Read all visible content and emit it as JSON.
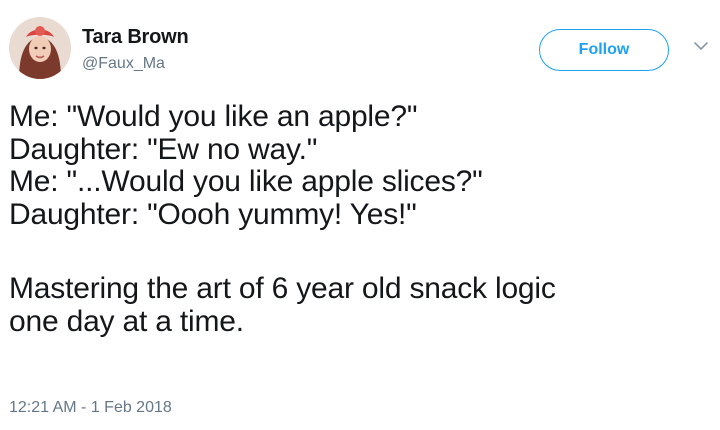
{
  "author": {
    "name": "Tara Brown",
    "handle": "@Faux_Ma"
  },
  "actions": {
    "follow_label": "Follow",
    "menu_icon": "chevron-down-icon"
  },
  "tweet": {
    "lines": [
      "Me: \"Would you like an apple?\"",
      "Daughter: \"Ew no way.\"",
      "Me: \"...Would you like apple slices?\"",
      "Daughter: \"Oooh yummy! Yes!\""
    ],
    "closing_lines": [
      "Mastering the art of 6 year old snack logic",
      "one day at a time."
    ],
    "timestamp": "12:21 AM - 1 Feb 2018"
  },
  "colors": {
    "accent": "#1da1f2",
    "text": "#14171a",
    "muted": "#657786"
  }
}
